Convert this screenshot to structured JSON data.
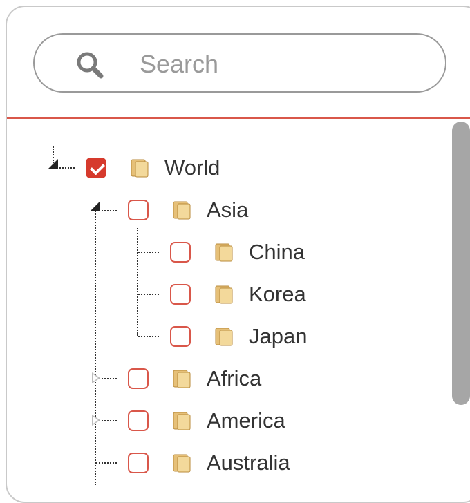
{
  "search": {
    "placeholder": "Search",
    "value": ""
  },
  "colors": {
    "accent": "#d63a2d",
    "divider": "#d9574a",
    "text": "#333333",
    "placeholder": "#9a9a9a",
    "scrollbar": "#a6a6a6"
  },
  "tree": {
    "nodes": [
      {
        "label": "World",
        "checked": true,
        "expanded": true,
        "level": 0
      },
      {
        "label": "Asia",
        "checked": false,
        "expanded": true,
        "level": 1
      },
      {
        "label": "China",
        "checked": false,
        "level": 2
      },
      {
        "label": "Korea",
        "checked": false,
        "level": 2
      },
      {
        "label": "Japan",
        "checked": false,
        "level": 2
      },
      {
        "label": "Africa",
        "checked": false,
        "expanded": false,
        "level": 1
      },
      {
        "label": "America",
        "checked": false,
        "expanded": false,
        "level": 1
      },
      {
        "label": "Australia",
        "checked": false,
        "level": 1
      }
    ]
  },
  "icons": {
    "search": "search-icon",
    "folder": "folder-icon",
    "expand_open": "expander-open-icon",
    "expand_closed": "expander-closed-icon"
  }
}
